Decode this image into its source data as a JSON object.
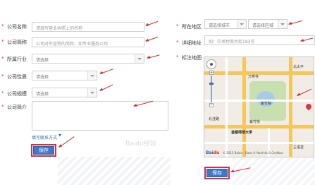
{
  "left_form": {
    "fields": [
      {
        "label": "公司名称",
        "placeholder": "请填写营业执照上的名称"
      },
      {
        "label": "公司简称",
        "placeholder": "公司对外宣称的简称，如专业服务公司"
      },
      {
        "label": "所属行业",
        "placeholder": "请选择"
      },
      {
        "label": "公司性质",
        "placeholder": "请选择"
      },
      {
        "label": "公司规模",
        "placeholder": "请选择"
      },
      {
        "label": "公司简介",
        "placeholder": ""
      }
    ],
    "contact_link": "填写联系方式",
    "contact_toggle": "▼",
    "save_label": "保存"
  },
  "right_form": {
    "region_label": "所在地区",
    "city_placeholder": "请选择城市",
    "district_placeholder": "请选择区域",
    "address_label": "详细地址",
    "address_placeholder": "如：中关村南大街183号",
    "map_label": "标注地图",
    "save_label": "保存"
  },
  "required_mark": "*",
  "map": {
    "labels": {
      "wanshou": "万寿寺",
      "ziwei": "紫竹院",
      "zizhu": "紫竹桥",
      "normal_university": "首都师范大学",
      "huayuan": "北洼路",
      "hengshan": "北太平",
      "zhuyang": "主语堂"
    },
    "copyright": "© 2013 Baidu - Data © NavInfo & CenNavi"
  },
  "watermark": "Baidu经验"
}
